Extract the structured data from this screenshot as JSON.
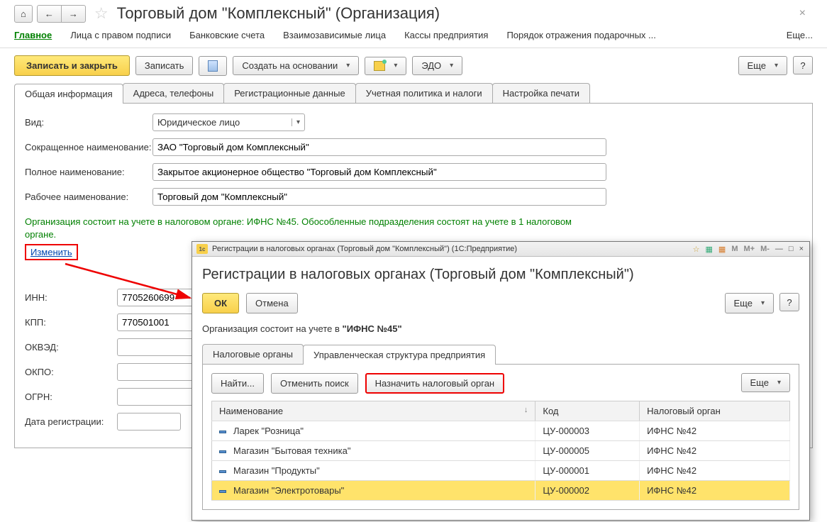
{
  "page_title": "Торговый дом \"Комплексный\" (Организация)",
  "nav": {
    "main": "Главное",
    "signers": "Лица с правом подписи",
    "bank": "Банковские счета",
    "related": "Взаимозависимые лица",
    "cash": "Кассы предприятия",
    "gift": "Порядок отражения подарочных ...",
    "more": "Еще..."
  },
  "cmd": {
    "save_close": "Записать и закрыть",
    "save": "Записать",
    "create_based": "Создать на основании",
    "edo": "ЭДО",
    "more": "Еще",
    "help": "?"
  },
  "tabs": {
    "t1": "Общая информация",
    "t2": "Адреса, телефоны",
    "t3": "Регистрационные данные",
    "t4": "Учетная политика и налоги",
    "t5": "Настройка печати"
  },
  "form": {
    "vid_label": "Вид:",
    "vid_value": "Юридическое лицо",
    "short_label": "Сокращенное наименование:",
    "short_value": "ЗАО \"Торговый дом Комплексный\"",
    "full_label": "Полное наименование:",
    "full_value": "Закрытое акционерное общество \"Торговый дом Комплексный\"",
    "work_label": "Рабочее наименование:",
    "work_value": "Торговый дом \"Комплексный\"",
    "note": "Организация состоит на учете в налоговом органе: ИФНС №45. Обособленные подразделения состоят на учете в 1 налоговом органе.",
    "change": "Изменить",
    "inn_label": "ИНН:",
    "inn_value": "7705260699",
    "kpp_label": "КПП:",
    "kpp_value": "770501001",
    "okved_label": "ОКВЭД:",
    "okved_value": "",
    "okpo_label": "ОКПО:",
    "okpo_value": "",
    "ogrn_label": "ОГРН:",
    "ogrn_value": "",
    "regdate_label": "Дата регистрации:",
    "regdate_value": ""
  },
  "dialog": {
    "title_bar": "Регистрации в налоговых органах (Торговый дом \"Комплексный\") (1С:Предприятие)",
    "title": "Регистрации в налоговых органах (Торговый дом \"Комплексный\")",
    "ok": "ОК",
    "cancel": "Отмена",
    "more": "Еще",
    "help": "?",
    "note_prefix": "Организация состоит на учете в ",
    "note_bold": "\"ИФНС №45\"",
    "tab1": "Налоговые органы",
    "tab2": "Управленческая структура предприятия",
    "find": "Найти...",
    "cancel_search": "Отменить поиск",
    "assign": "Назначить налоговый орган",
    "col_name": "Наименование",
    "col_code": "Код",
    "col_tax": "Налоговый орган",
    "rows": [
      {
        "name": "Ларек \"Розница\"",
        "code": "ЦУ-000003",
        "tax": "ИФНС №42"
      },
      {
        "name": "Магазин \"Бытовая техника\"",
        "code": "ЦУ-000005",
        "tax": "ИФНС №42"
      },
      {
        "name": "Магазин \"Продукты\"",
        "code": "ЦУ-000001",
        "tax": "ИФНС №42"
      },
      {
        "name": "Магазин \"Электротовары\"",
        "code": "ЦУ-000002",
        "tax": "ИФНС №42"
      }
    ]
  },
  "calc": {
    "m": "M",
    "mplus": "M+",
    "mminus": "M-"
  }
}
